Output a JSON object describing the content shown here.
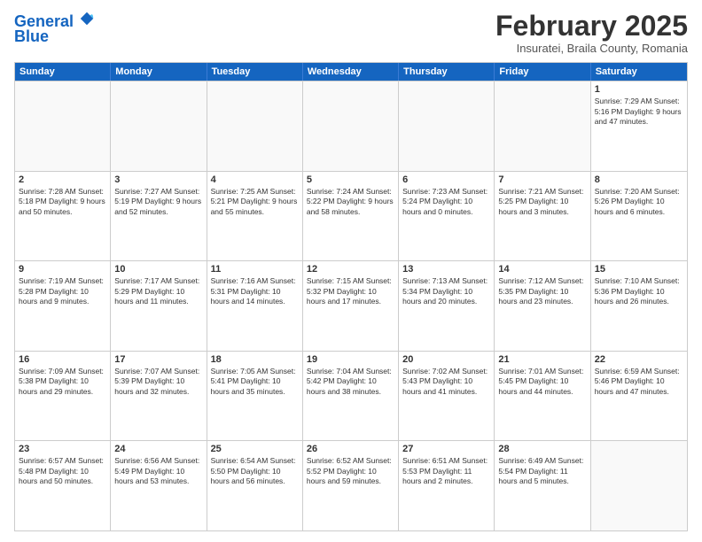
{
  "logo": {
    "line1": "General",
    "line2": "Blue"
  },
  "title": "February 2025",
  "location": "Insuratei, Braila County, Romania",
  "days_of_week": [
    "Sunday",
    "Monday",
    "Tuesday",
    "Wednesday",
    "Thursday",
    "Friday",
    "Saturday"
  ],
  "rows": [
    [
      {
        "day": "",
        "empty": true
      },
      {
        "day": "",
        "empty": true
      },
      {
        "day": "",
        "empty": true
      },
      {
        "day": "",
        "empty": true
      },
      {
        "day": "",
        "empty": true
      },
      {
        "day": "",
        "empty": true
      },
      {
        "day": "1",
        "text": "Sunrise: 7:29 AM\nSunset: 5:16 PM\nDaylight: 9 hours and 47 minutes."
      }
    ],
    [
      {
        "day": "2",
        "text": "Sunrise: 7:28 AM\nSunset: 5:18 PM\nDaylight: 9 hours and 50 minutes."
      },
      {
        "day": "3",
        "text": "Sunrise: 7:27 AM\nSunset: 5:19 PM\nDaylight: 9 hours and 52 minutes."
      },
      {
        "day": "4",
        "text": "Sunrise: 7:25 AM\nSunset: 5:21 PM\nDaylight: 9 hours and 55 minutes."
      },
      {
        "day": "5",
        "text": "Sunrise: 7:24 AM\nSunset: 5:22 PM\nDaylight: 9 hours and 58 minutes."
      },
      {
        "day": "6",
        "text": "Sunrise: 7:23 AM\nSunset: 5:24 PM\nDaylight: 10 hours and 0 minutes."
      },
      {
        "day": "7",
        "text": "Sunrise: 7:21 AM\nSunset: 5:25 PM\nDaylight: 10 hours and 3 minutes."
      },
      {
        "day": "8",
        "text": "Sunrise: 7:20 AM\nSunset: 5:26 PM\nDaylight: 10 hours and 6 minutes."
      }
    ],
    [
      {
        "day": "9",
        "text": "Sunrise: 7:19 AM\nSunset: 5:28 PM\nDaylight: 10 hours and 9 minutes."
      },
      {
        "day": "10",
        "text": "Sunrise: 7:17 AM\nSunset: 5:29 PM\nDaylight: 10 hours and 11 minutes."
      },
      {
        "day": "11",
        "text": "Sunrise: 7:16 AM\nSunset: 5:31 PM\nDaylight: 10 hours and 14 minutes."
      },
      {
        "day": "12",
        "text": "Sunrise: 7:15 AM\nSunset: 5:32 PM\nDaylight: 10 hours and 17 minutes."
      },
      {
        "day": "13",
        "text": "Sunrise: 7:13 AM\nSunset: 5:34 PM\nDaylight: 10 hours and 20 minutes."
      },
      {
        "day": "14",
        "text": "Sunrise: 7:12 AM\nSunset: 5:35 PM\nDaylight: 10 hours and 23 minutes."
      },
      {
        "day": "15",
        "text": "Sunrise: 7:10 AM\nSunset: 5:36 PM\nDaylight: 10 hours and 26 minutes."
      }
    ],
    [
      {
        "day": "16",
        "text": "Sunrise: 7:09 AM\nSunset: 5:38 PM\nDaylight: 10 hours and 29 minutes."
      },
      {
        "day": "17",
        "text": "Sunrise: 7:07 AM\nSunset: 5:39 PM\nDaylight: 10 hours and 32 minutes."
      },
      {
        "day": "18",
        "text": "Sunrise: 7:05 AM\nSunset: 5:41 PM\nDaylight: 10 hours and 35 minutes."
      },
      {
        "day": "19",
        "text": "Sunrise: 7:04 AM\nSunset: 5:42 PM\nDaylight: 10 hours and 38 minutes."
      },
      {
        "day": "20",
        "text": "Sunrise: 7:02 AM\nSunset: 5:43 PM\nDaylight: 10 hours and 41 minutes."
      },
      {
        "day": "21",
        "text": "Sunrise: 7:01 AM\nSunset: 5:45 PM\nDaylight: 10 hours and 44 minutes."
      },
      {
        "day": "22",
        "text": "Sunrise: 6:59 AM\nSunset: 5:46 PM\nDaylight: 10 hours and 47 minutes."
      }
    ],
    [
      {
        "day": "23",
        "text": "Sunrise: 6:57 AM\nSunset: 5:48 PM\nDaylight: 10 hours and 50 minutes."
      },
      {
        "day": "24",
        "text": "Sunrise: 6:56 AM\nSunset: 5:49 PM\nDaylight: 10 hours and 53 minutes."
      },
      {
        "day": "25",
        "text": "Sunrise: 6:54 AM\nSunset: 5:50 PM\nDaylight: 10 hours and 56 minutes."
      },
      {
        "day": "26",
        "text": "Sunrise: 6:52 AM\nSunset: 5:52 PM\nDaylight: 10 hours and 59 minutes."
      },
      {
        "day": "27",
        "text": "Sunrise: 6:51 AM\nSunset: 5:53 PM\nDaylight: 11 hours and 2 minutes."
      },
      {
        "day": "28",
        "text": "Sunrise: 6:49 AM\nSunset: 5:54 PM\nDaylight: 11 hours and 5 minutes."
      },
      {
        "day": "",
        "empty": true
      }
    ]
  ]
}
